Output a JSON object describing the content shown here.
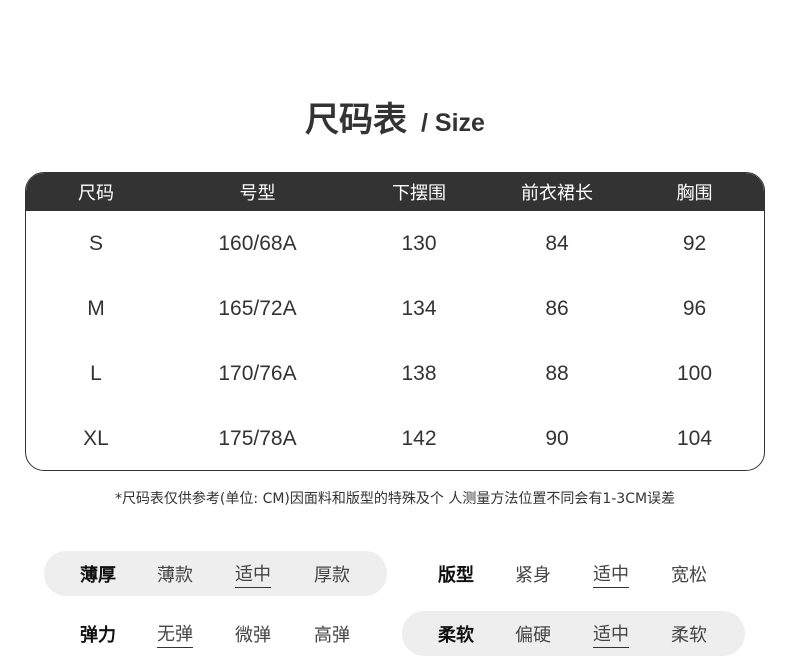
{
  "header": {
    "title_cn": "尺码表",
    "title_en": "/ Size"
  },
  "size_table": {
    "columns": [
      "尺码",
      "号型",
      "下摆围",
      "前衣裙长",
      "胸围"
    ],
    "rows": [
      [
        "S",
        "160/68A",
        "130",
        "84",
        "92"
      ],
      [
        "M",
        "165/72A",
        "134",
        "86",
        "96"
      ],
      [
        "L",
        "170/76A",
        "138",
        "88",
        "100"
      ],
      [
        "XL",
        "175/78A",
        "142",
        "90",
        "104"
      ]
    ]
  },
  "note": "*尺码表仅供参考(单位: CM)因面料和版型的特殊及个 人测量方法位置不同会有1-3CM误差",
  "features": {
    "thickness": {
      "label": "薄厚",
      "options": [
        "薄款",
        "适中",
        "厚款"
      ],
      "selected": "适中"
    },
    "fit": {
      "label": "版型",
      "options": [
        "紧身",
        "适中",
        "宽松"
      ],
      "selected": "适中"
    },
    "elasticity": {
      "label": "弹力",
      "options": [
        "无弹",
        "微弹",
        "高弹"
      ],
      "selected": "无弹"
    },
    "softness": {
      "label": "柔软",
      "options": [
        "偏硬",
        "适中",
        "柔软"
      ],
      "selected": "适中"
    }
  }
}
